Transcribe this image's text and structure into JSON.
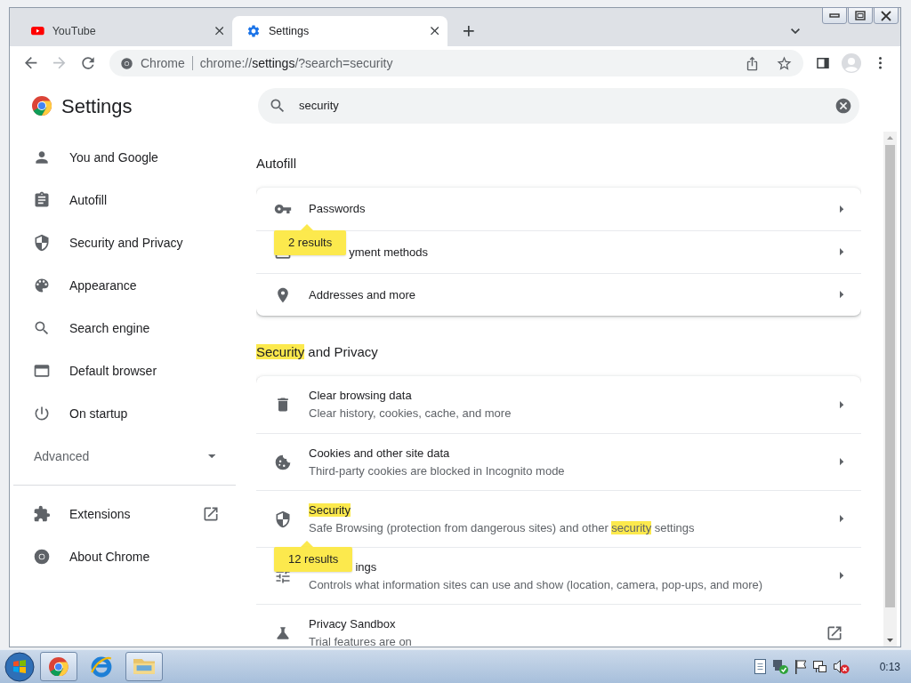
{
  "tabs": [
    {
      "title": "YouTube",
      "kind": "video",
      "selected": false
    },
    {
      "title": "Settings",
      "kind": "settings",
      "selected": true
    }
  ],
  "nav_buttons": [
    {
      "kind": "back",
      "disabled": false
    },
    {
      "kind": "forward",
      "disabled": true
    },
    {
      "kind": "reload",
      "disabled": false
    }
  ],
  "address_bar": {
    "site_label": "Chrome",
    "url": [
      {
        "text": "chrome://",
        "emphasized": false
      },
      {
        "text": "settings",
        "emphasized": true
      },
      {
        "text": "/?search=security",
        "emphasized": false
      }
    ]
  },
  "settings": {
    "title": "Settings",
    "search": {
      "value": "security"
    }
  },
  "sidebar": {
    "items": [
      {
        "label": "You and Google",
        "kind": "person"
      },
      {
        "label": "Autofill",
        "kind": "clipboard"
      },
      {
        "label": "Security and Privacy",
        "kind": "shield"
      },
      {
        "label": "Appearance",
        "kind": "palette"
      },
      {
        "label": "Search engine",
        "kind": "search"
      },
      {
        "label": "Default browser",
        "kind": "browser"
      },
      {
        "label": "On startup",
        "kind": "power"
      }
    ],
    "advanced": {
      "label": "Advanced",
      "expanded": false
    },
    "links": [
      {
        "label": "Extensions",
        "kind": "puzzle",
        "external": true
      },
      {
        "label": "About Chrome",
        "kind": "chrome",
        "external": false
      }
    ]
  },
  "sections": [
    {
      "title": [
        {
          "text": "Autofill",
          "highlighted": false
        }
      ],
      "rows": [
        {
          "kind": "key",
          "label": [
            {
              "text": "Passwords",
              "highlighted": false
            }
          ],
          "external": false
        },
        {
          "kind": "card",
          "label": [
            {
              "text": "yment methods",
              "highlighted": false
            }
          ],
          "external": false,
          "bubble": "2 results"
        },
        {
          "kind": "pin",
          "label": [
            {
              "text": "Addresses and more",
              "highlighted": false
            }
          ],
          "external": false
        }
      ]
    },
    {
      "title": [
        {
          "text": "Security",
          "highlighted": true
        },
        {
          "text": " and Privacy",
          "highlighted": false
        }
      ],
      "rows": [
        {
          "kind": "trash",
          "label": [
            {
              "text": "Clear browsing data",
              "highlighted": false
            }
          ],
          "sublabel": [
            {
              "text": "Clear history, cookies, cache, and more",
              "highlighted": false
            }
          ],
          "external": false
        },
        {
          "kind": "cookie",
          "label": [
            {
              "text": "Cookies and other site data",
              "highlighted": false
            }
          ],
          "sublabel": [
            {
              "text": "Third-party cookies are blocked in Incognito mode",
              "highlighted": false
            }
          ],
          "external": false
        },
        {
          "kind": "shield",
          "label": [
            {
              "text": "Security",
              "highlighted": true
            }
          ],
          "sublabel": [
            {
              "text": "Safe Browsing (protection from dangerous sites) and other ",
              "highlighted": false
            },
            {
              "text": "security",
              "highlighted": true
            },
            {
              "text": " settings",
              "highlighted": false
            }
          ],
          "external": false
        },
        {
          "kind": "tune",
          "label": [
            {
              "text": "ings",
              "highlighted": false
            }
          ],
          "sublabel": [
            {
              "text": "Controls what information sites can use and show (location, camera, pop-ups, and more)",
              "highlighted": false
            }
          ],
          "external": false,
          "bubble": "12 results"
        },
        {
          "kind": "flask",
          "label": [
            {
              "text": "Privacy Sandbox",
              "highlighted": false
            }
          ],
          "sublabel": [
            {
              "text": "Trial features are on",
              "highlighted": false
            }
          ],
          "external": true
        }
      ]
    }
  ],
  "taskbar": {
    "apps": [
      {
        "kind": "chrome",
        "running": true
      },
      {
        "kind": "ie",
        "running": false
      },
      {
        "kind": "folder",
        "running": true
      }
    ],
    "clock": "0:13"
  }
}
